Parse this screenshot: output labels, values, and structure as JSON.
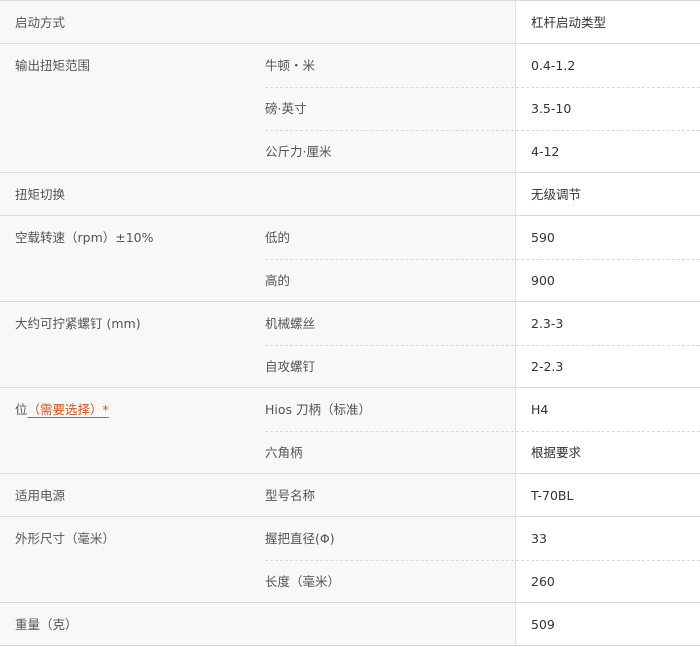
{
  "rows": [
    {
      "label": "启动方式",
      "subs": [
        {
          "name": "",
          "value": "杠杆启动类型"
        }
      ]
    },
    {
      "label": "输出扭矩范围",
      "subs": [
        {
          "name": "牛顿・米",
          "value": "0.4-1.2"
        },
        {
          "name": "磅·英寸",
          "value": "3.5-10"
        },
        {
          "name": "公斤力·厘米",
          "value": "4-12"
        }
      ]
    },
    {
      "label": "扭矩切换",
      "subs": [
        {
          "name": "",
          "value": "无级调节"
        }
      ]
    },
    {
      "label": "空载转速（rpm）±10%",
      "subs": [
        {
          "name": "低的",
          "value": "590"
        },
        {
          "name": "高的",
          "value": "900"
        }
      ]
    },
    {
      "label": "大约可拧紧螺钉 (mm)",
      "subs": [
        {
          "name": "机械螺丝",
          "value": "2.3-3"
        },
        {
          "name": "自攻螺钉",
          "value": "2-2.3"
        }
      ]
    },
    {
      "label": "位",
      "label_link": "（需要选择）*",
      "subs": [
        {
          "name": "Hios 刀柄（标准）",
          "value": "H4"
        },
        {
          "name": "六角柄",
          "value": "根据要求"
        }
      ]
    },
    {
      "label": "适用电源",
      "subs": [
        {
          "name": "型号名称",
          "value": "T-70BL"
        }
      ]
    },
    {
      "label": "外形尺寸（毫米）",
      "subs": [
        {
          "name": "握把直径(Φ)",
          "value": "33"
        },
        {
          "name": "长度（毫米）",
          "value": "260"
        }
      ]
    },
    {
      "label": "重量（克）",
      "subs": [
        {
          "name": "",
          "value": "509"
        }
      ]
    }
  ]
}
